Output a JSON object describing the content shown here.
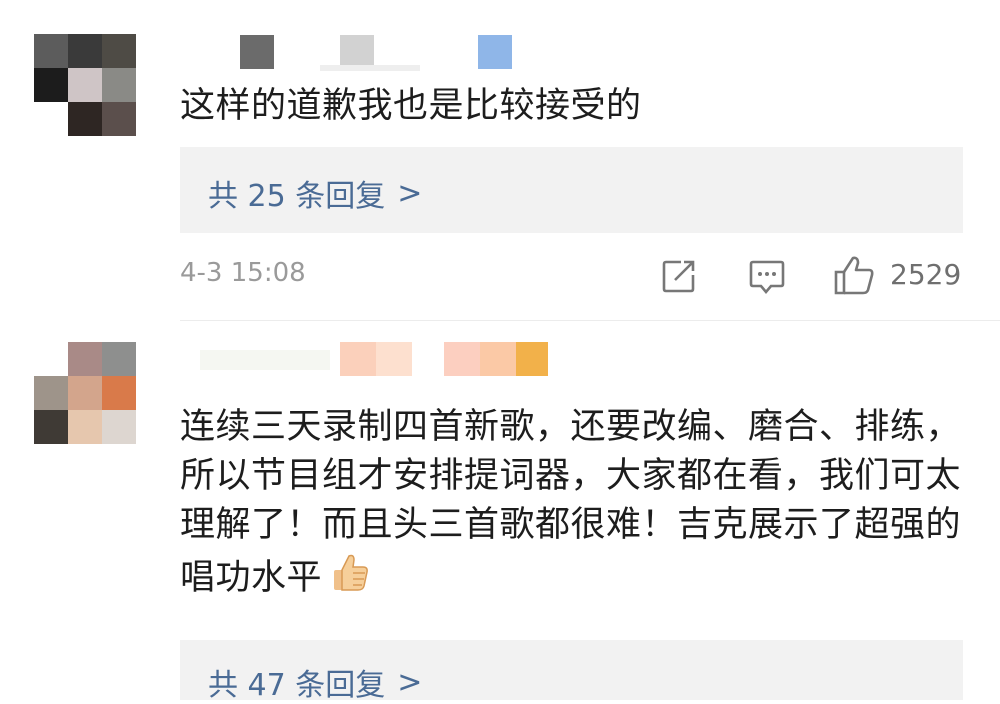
{
  "comments": [
    {
      "text": "这样的道歉我也是比较接受的",
      "replies_label": "共 25 条回复",
      "replies_chevron": ">",
      "timestamp": "4-3 15:08",
      "like_count": "2529"
    },
    {
      "text": "连续三天录制四首新歌，还要改编、磨合、排练，所以节目组才安排提词器，大家都在看，我们可太理解了！而且头三首歌都很难！吉克展示了超强的唱功水平",
      "replies_label": "共 47 条回复",
      "replies_chevron": ">"
    }
  ],
  "icons": {
    "share": "share-icon",
    "comment": "comment-icon",
    "like": "thumbs-up-icon",
    "emoji": "thumbs-up-emoji-icon"
  },
  "colors": {
    "reply_link": "#4a6b95",
    "reply_box_bg": "#f2f2f2",
    "meta_gray": "#9a9a9a"
  }
}
